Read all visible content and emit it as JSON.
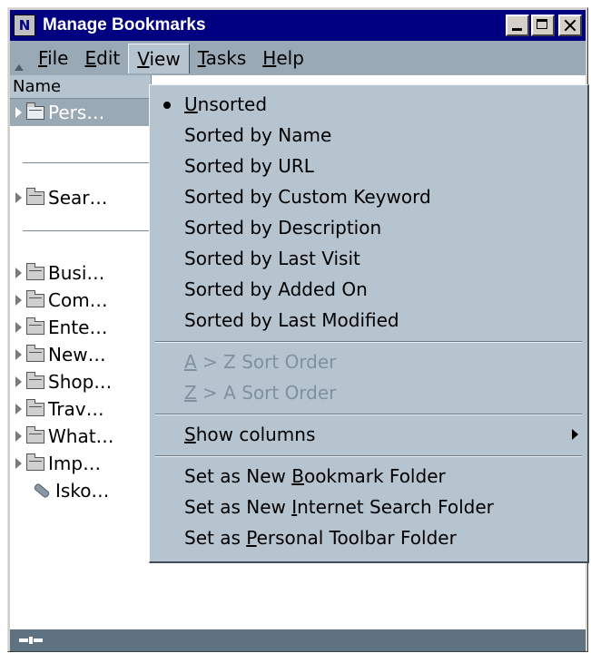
{
  "window": {
    "title": "Manage Bookmarks",
    "app_icon": "N"
  },
  "menubar": {
    "items": [
      {
        "pre": "",
        "key": "F",
        "post": "ile"
      },
      {
        "pre": "",
        "key": "E",
        "post": "dit"
      },
      {
        "pre": "",
        "key": "V",
        "post": "iew"
      },
      {
        "pre": "",
        "key": "T",
        "post": "asks"
      },
      {
        "pre": "",
        "key": "H",
        "post": "elp"
      }
    ]
  },
  "tree": {
    "column_header": "Name",
    "rows": [
      {
        "label": "Pers…",
        "type": "folder",
        "selected": true
      },
      {
        "label": "Sear…",
        "type": "folder"
      },
      {
        "label": "Busi…",
        "type": "folder"
      },
      {
        "label": "Com…",
        "type": "folder"
      },
      {
        "label": "Ente…",
        "type": "folder"
      },
      {
        "label": "New…",
        "type": "folder"
      },
      {
        "label": "Shop…",
        "type": "folder"
      },
      {
        "label": "Trav…",
        "type": "folder"
      },
      {
        "label": "What…",
        "type": "folder"
      },
      {
        "label": "Imp…",
        "type": "folder"
      },
      {
        "label": "Isko…",
        "type": "bookmark"
      }
    ]
  },
  "view_menu": {
    "sort_items": [
      {
        "pre": "",
        "key": "U",
        "post": "nsorted",
        "checked": true
      },
      {
        "pre": "Sorted by Name",
        "key": "",
        "post": ""
      },
      {
        "pre": "Sorted by URL",
        "key": "",
        "post": ""
      },
      {
        "pre": "Sorted by Custom Keyword",
        "key": "",
        "post": ""
      },
      {
        "pre": "Sorted by Description",
        "key": "",
        "post": ""
      },
      {
        "pre": "Sorted by Last Visit",
        "key": "",
        "post": ""
      },
      {
        "pre": "Sorted by Added On",
        "key": "",
        "post": ""
      },
      {
        "pre": "Sorted by Last Modified",
        "key": "",
        "post": ""
      }
    ],
    "order_items": [
      {
        "pre": "",
        "key": "A",
        "post": " > Z Sort Order",
        "disabled": true
      },
      {
        "pre": "",
        "key": "Z",
        "post": " > A Sort Order",
        "disabled": true
      }
    ],
    "show_columns": {
      "pre": "",
      "key": "S",
      "post": "how columns"
    },
    "folder_items": [
      {
        "pre": "Set as New ",
        "key": "B",
        "post": "ookmark Folder"
      },
      {
        "pre": "Set as New ",
        "key": "I",
        "post": "nternet Search Folder"
      },
      {
        "pre": "Set as ",
        "key": "P",
        "post": "ersonal Toolbar Folder"
      }
    ]
  }
}
